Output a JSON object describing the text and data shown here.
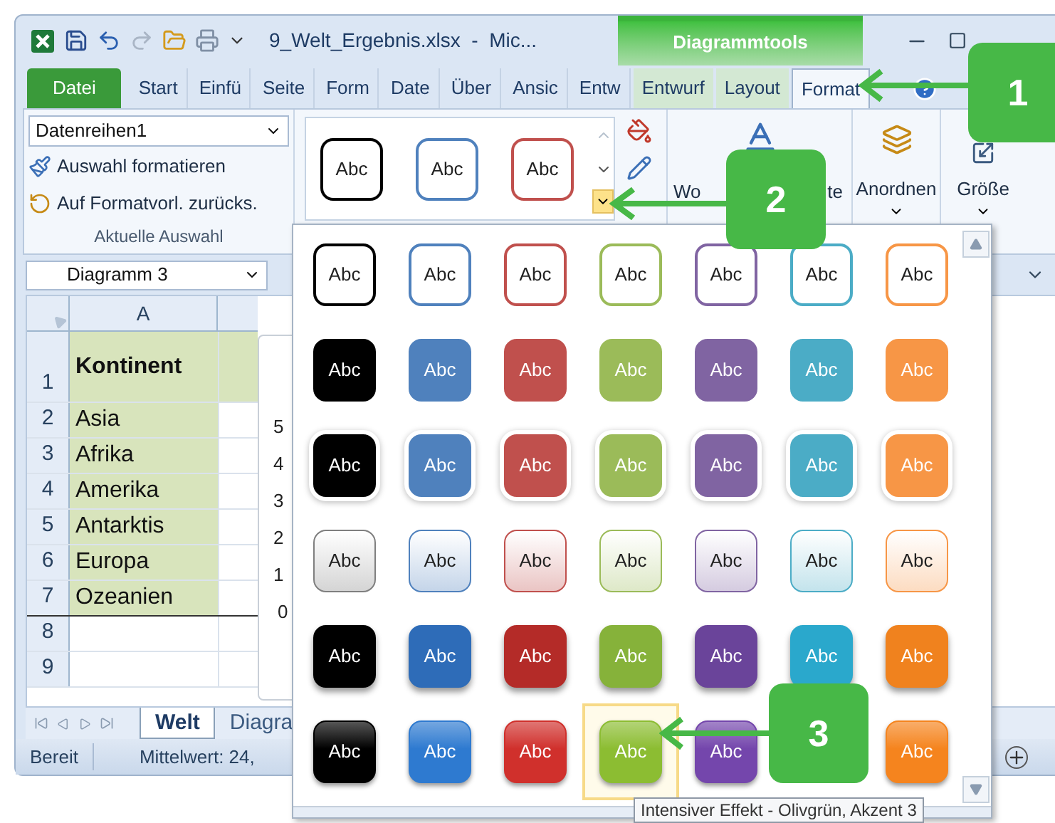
{
  "title_bar": {
    "file_title": "9_Welt_Ergebnis.xlsx  -  Mic...",
    "context_header": "Diagrammtools"
  },
  "tabs": [
    {
      "label": "Datei",
      "kind": "file",
      "selected": false
    },
    {
      "label": "Start",
      "kind": "normal",
      "selected": false
    },
    {
      "label": "Einfü",
      "kind": "normal",
      "selected": false
    },
    {
      "label": "Seite",
      "kind": "normal",
      "selected": false
    },
    {
      "label": "Form",
      "kind": "normal",
      "selected": false
    },
    {
      "label": "Date",
      "kind": "normal",
      "selected": false
    },
    {
      "label": "Über",
      "kind": "normal",
      "selected": false
    },
    {
      "label": "Ansic",
      "kind": "normal",
      "selected": false
    },
    {
      "label": "Entw",
      "kind": "normal",
      "selected": false
    },
    {
      "label": "Entwurf",
      "kind": "context",
      "selected": false
    },
    {
      "label": "Layout",
      "kind": "context",
      "selected": false
    },
    {
      "label": "Format",
      "kind": "context",
      "selected": true
    }
  ],
  "ribbon": {
    "selection_dropdown": "Datenreihen1",
    "commands": [
      "Auswahl formatieren",
      "Auf Formatvorl. zurücks."
    ],
    "group_label": "Aktuelle Auswahl",
    "shape_styles": [
      {
        "label": "Abc",
        "color": "#000000"
      },
      {
        "label": "Abc",
        "color": "#4f81bd"
      },
      {
        "label": "Abc",
        "color": "#c0504d"
      }
    ],
    "wordart_label_parts": [
      "Wo",
      "te"
    ],
    "arrange_label": "Anordnen",
    "size_label": "Größe"
  },
  "name_box": "Diagramm 3",
  "column_headers": [
    "A"
  ],
  "rows": [
    {
      "number": "1",
      "cell": "Kontinent"
    },
    {
      "number": "2",
      "cell": "Asia"
    },
    {
      "number": "3",
      "cell": "Afrika"
    },
    {
      "number": "4",
      "cell": "Amerika"
    },
    {
      "number": "5",
      "cell": "Antarktis"
    },
    {
      "number": "6",
      "cell": "Europa"
    },
    {
      "number": "7",
      "cell": "Ozeanien"
    },
    {
      "number": "8"
    },
    {
      "number": "9"
    }
  ],
  "chart_axis_labels": [
    "5",
    "4",
    "3",
    "2",
    "1",
    "0"
  ],
  "sheet_tabs": [
    {
      "label": "Welt",
      "selected": true
    },
    {
      "label": "Diagra",
      "selected": false
    }
  ],
  "status_bar": {
    "mode": "Bereit",
    "summary": "Mittelwert: 24,"
  },
  "gallery": {
    "rows": [
      {
        "kind": "outline",
        "items": [
          {
            "label": "Abc",
            "color": "#000000",
            "selected": false
          },
          {
            "label": "Abc",
            "color": "#4f81bd",
            "selected": false
          },
          {
            "label": "Abc",
            "color": "#c0504d",
            "selected": false
          },
          {
            "label": "Abc",
            "color": "#9bbb59",
            "selected": false
          },
          {
            "label": "Abc",
            "color": "#8064a2",
            "selected": false
          },
          {
            "label": "Abc",
            "color": "#4bacc6",
            "selected": false
          },
          {
            "label": "Abc",
            "color": "#f79646",
            "selected": false
          }
        ]
      },
      {
        "kind": "filled",
        "items": [
          {
            "label": "Abc",
            "color": "#000000",
            "selected": false
          },
          {
            "label": "Abc",
            "color": "#4f81bd",
            "selected": false
          },
          {
            "label": "Abc",
            "color": "#c0504d",
            "selected": false
          },
          {
            "label": "Abc",
            "color": "#9bbb59",
            "selected": false
          },
          {
            "label": "Abc",
            "color": "#8064a2",
            "selected": false
          },
          {
            "label": "Abc",
            "color": "#4bacc6",
            "selected": false
          },
          {
            "label": "Abc",
            "color": "#f79646",
            "selected": false
          }
        ]
      },
      {
        "kind": "moderate",
        "items": [
          {
            "label": "Abc",
            "color": "#000000",
            "selected": false
          },
          {
            "label": "Abc",
            "color": "#4f81bd",
            "selected": false
          },
          {
            "label": "Abc",
            "color": "#c0504d",
            "selected": false
          },
          {
            "label": "Abc",
            "color": "#9bbb59",
            "selected": false
          },
          {
            "label": "Abc",
            "color": "#8064a2",
            "selected": false
          },
          {
            "label": "Abc",
            "color": "#4bacc6",
            "selected": false
          },
          {
            "label": "Abc",
            "color": "#f79646",
            "selected": false
          }
        ]
      },
      {
        "kind": "subtle",
        "items": [
          {
            "label": "Abc",
            "color": "#7f7f7f",
            "selected": false
          },
          {
            "label": "Abc",
            "color": "#4f81bd",
            "selected": false
          },
          {
            "label": "Abc",
            "color": "#c0504d",
            "selected": false
          },
          {
            "label": "Abc",
            "color": "#9bbb59",
            "selected": false
          },
          {
            "label": "Abc",
            "color": "#8064a2",
            "selected": false
          },
          {
            "label": "Abc",
            "color": "#4bacc6",
            "selected": false
          },
          {
            "label": "Abc",
            "color": "#f79646",
            "selected": false
          }
        ]
      },
      {
        "kind": "intense",
        "items": [
          {
            "label": "Abc",
            "color": "#000000",
            "selected": false
          },
          {
            "label": "Abc",
            "color": "#2e6cb8",
            "selected": false
          },
          {
            "label": "Abc",
            "color": "#b42b28",
            "selected": false
          },
          {
            "label": "Abc",
            "color": "#86b23a",
            "selected": false
          },
          {
            "label": "Abc",
            "color": "#6a449a",
            "selected": false
          },
          {
            "label": "Abc",
            "color": "#2aa8cc",
            "selected": false
          },
          {
            "label": "Abc",
            "color": "#f0821e",
            "selected": false
          }
        ]
      },
      {
        "kind": "glossy",
        "items": [
          {
            "label": "Abc",
            "color": "#000000",
            "selected": false
          },
          {
            "label": "Abc",
            "color": "#2e7ad0",
            "selected": false
          },
          {
            "label": "Abc",
            "color": "#d0302c",
            "selected": false
          },
          {
            "label": "Abc",
            "color": "#8cbd32",
            "selected": true
          },
          {
            "label": "Abc",
            "color": "#7446ac",
            "selected": false
          },
          {
            "label": "Abc",
            "color": "#f5841e",
            "selected": false
          }
        ]
      }
    ],
    "tooltip": "Intensiver Effekt - Olivgrün, Akzent 3"
  },
  "callouts": [
    {
      "number": "1"
    },
    {
      "number": "2"
    },
    {
      "number": "3"
    }
  ]
}
